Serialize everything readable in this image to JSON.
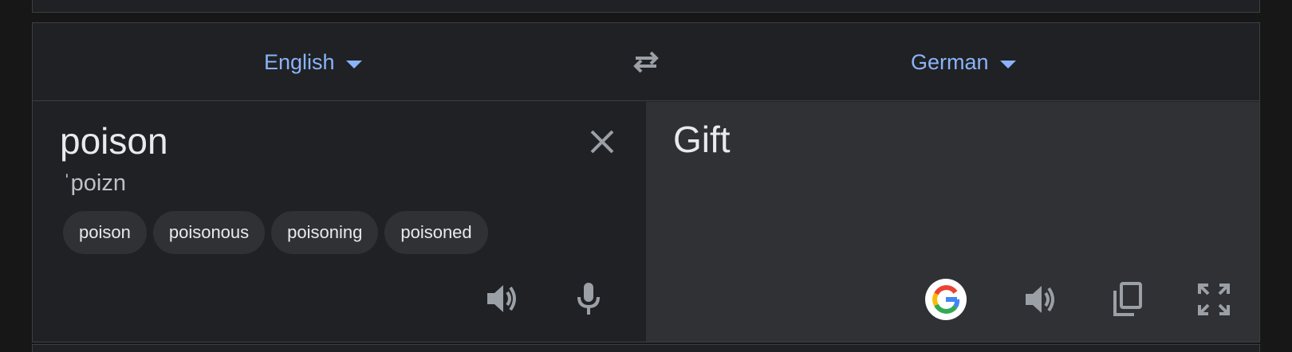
{
  "source_language": {
    "label": "English"
  },
  "target_language": {
    "label": "German"
  },
  "source": {
    "text": "poison",
    "phonetic": "ˈpoizn",
    "suggestions": [
      "poison",
      "poisonous",
      "poisoning",
      "poisoned"
    ]
  },
  "target": {
    "text": "Gift"
  },
  "icons": {
    "swap": "swap-languages-icon",
    "clear": "close-icon",
    "source_listen": "speaker-icon",
    "microphone": "microphone-icon",
    "google": "google-logo-icon",
    "target_listen": "speaker-icon",
    "copy": "copy-icon",
    "fullscreen": "fullscreen-icon"
  },
  "colors": {
    "accent": "#8ab4f8",
    "source_background": "#202124",
    "target_background": "#303134",
    "text": "#e8eaed",
    "icon": "#9aa0a6"
  }
}
